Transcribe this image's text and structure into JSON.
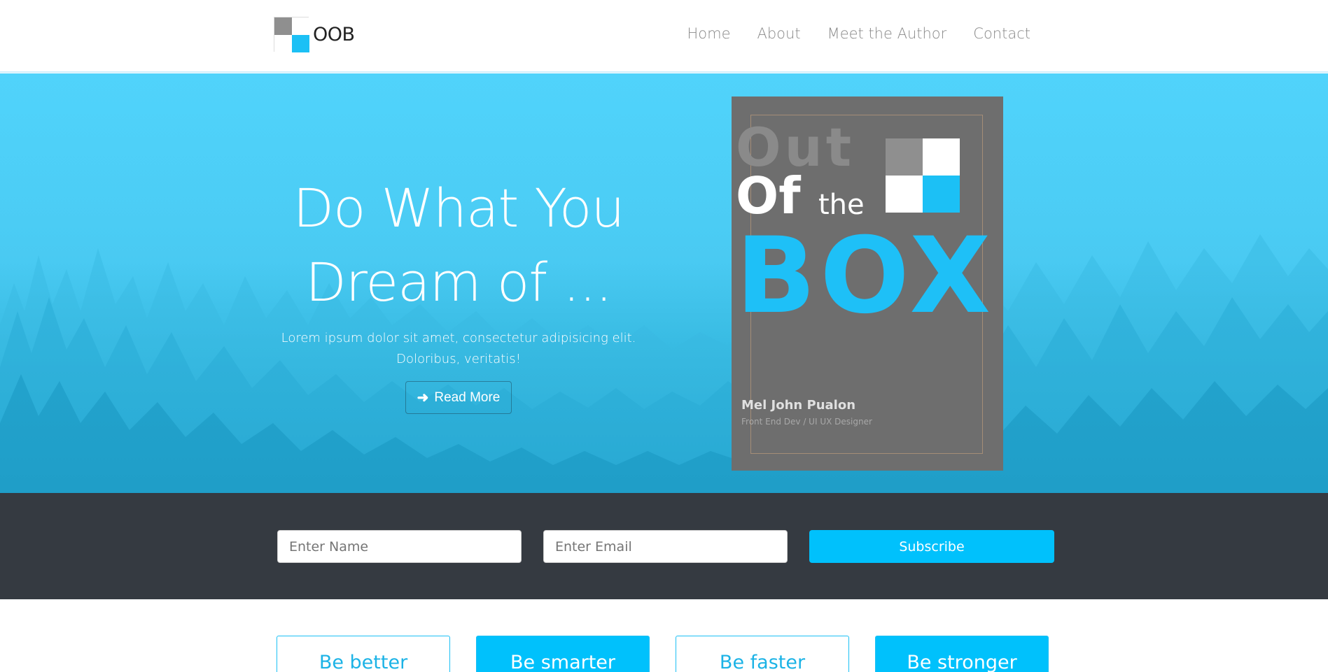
{
  "brand": {
    "logo_icon": "logo-squares-icon",
    "name": "OOB"
  },
  "nav": {
    "items": [
      {
        "label": "Home"
      },
      {
        "label": "About"
      },
      {
        "label": "Meet the Author"
      },
      {
        "label": "Contact"
      }
    ]
  },
  "hero": {
    "title_line1": "Do What You",
    "title_line2": "Dream of ...",
    "subtitle": "Lorem ipsum dolor sit amet, consectetur adipisicing elit. Doloribus, veritatis!",
    "button_icon": "arrow-right-icon",
    "button_label": "Read More"
  },
  "book": {
    "word_out": "Out",
    "word_of": "Of",
    "word_the": "the",
    "word_box": "BOX",
    "author": "Mel John Pualon",
    "role": "Front End Dev / UI UX Designer"
  },
  "subscribe": {
    "name_placeholder": "Enter Name",
    "email_placeholder": "Enter Email",
    "button_label": "Subscribe"
  },
  "features": [
    {
      "label": "Be better"
    },
    {
      "label": "Be smarter"
    },
    {
      "label": "Be faster"
    },
    {
      "label": "Be stronger"
    }
  ],
  "colors": {
    "accent": "#00c1fc",
    "hero_bg": "#4dcef6",
    "dark_bar": "#353a41",
    "book_bg": "#6e6e6e"
  }
}
